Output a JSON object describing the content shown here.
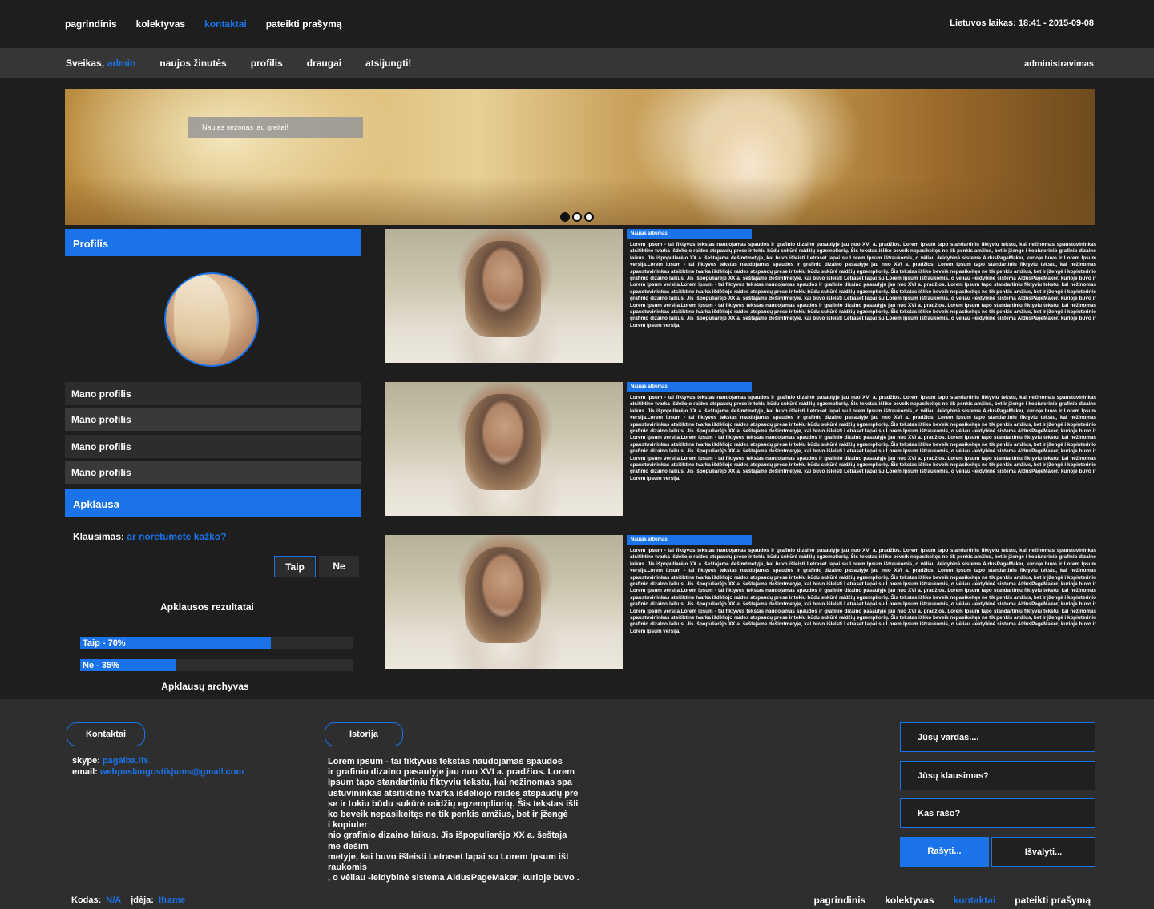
{
  "topnav": {
    "items": [
      "pagrindinis",
      "kolektyvas",
      "kontaktai",
      "pateikti prašymą"
    ],
    "active_index": 2,
    "clock": "Lietuvos laikas: 18:41 - 2015-09-08"
  },
  "userbar": {
    "greeting": "Sveikas,",
    "username": "admin",
    "items": [
      "naujos žinutės",
      "profilis",
      "draugai",
      "atsijungti!"
    ],
    "admin": "administravimas"
  },
  "banner": {
    "caption": "Naujas sezonas jau greitai!",
    "slides": 3,
    "active_slide": 0
  },
  "sidebar": {
    "profile_title": "Profilis",
    "menu": [
      "Mano profilis",
      "Mano profilis",
      "Mano profilis",
      "Mano profilis"
    ],
    "poll_title": "Apklausa",
    "question_label": "Klausimas:",
    "question": "ar norėtumėte kažko?",
    "yes": "Taip",
    "no": "Ne",
    "results_title": "Apklausos rezultatai",
    "results": [
      {
        "label": "Taip - 70%",
        "percent": 70
      },
      {
        "label": "Ne - 35%",
        "percent": 35
      }
    ],
    "archive": "Apklausų archyvas"
  },
  "articles": [
    {
      "tag": "Naujas albumas",
      "text": "Lorem ipsum - tai fiktyvus tekstas naudojamas spaudos ir grafinio dizaino pasaulyje jau nuo XVI a. pradžios. Lorem Ipsum tapo standartiniu fiktyviu tekstu, kai nežinomas spaustuvininkas atsitiktine tvarka išdėliojo raides atspaudų prese ir tokiu būdu sukūrė raidžių egzempliorių. Šis tekstas išliko beveik nepasikeitęs ne tik penkis amžius, bet ir įžengė i kopiuterinio grafinio dizaino laikus. Jis išpopuliarėjo XX a. šeštajame dešimtmetyje, kai buvo išleisti Letraset lapai su Lorem Ipsum ištraukomis, o vėliau -leidybinė sistema AldusPageMaker, kurioje buvo ir Lorem Ipsum versija.Lorem ipsum - tai fiktyvus tekstas naudojamas spaudos ir grafinio dizaino pasaulyje jau nuo XVI a. pradžios. Lorem Ipsum tapo standartiniu fiktyviu tekstu, kai nežinomas spaustuvininkas atsitiktine tvarka išdėliojo raides atspaudų prese ir tokiu būdu sukūrė raidžių egzempliorių. Šis tekstas išliko beveik nepasikeitęs ne tik penkis amžius, bet ir įžengė i kopiuterinio grafinio dizaino laikus. Jis išpopuliarėjo XX a. šeštajame dešimtmetyje, kai buvo išleisti Letraset lapai su Lorem Ipsum ištraukomis, o vėliau -leidybinė sistema AldusPageMaker, kurioje buvo ir Lorem Ipsum versija.Lorem ipsum - tai fiktyvus tekstas naudojamas spaudos ir grafinio dizaino pasaulyje jau nuo XVI a. pradžios. Lorem Ipsum tapo standartiniu fiktyviu tekstu, kai nežinomas spaustuvininkas atsitiktine tvarka išdėliojo raides atspaudų prese ir tokiu būdu sukūrė raidžių egzempliorių. Šis tekstas išliko beveik nepasikeitęs ne tik penkis amžius, bet ir įžengė i kopiuterinio grafinio dizaino laikus. Jis išpopuliarėjo XX a. šeštajame dešimtmetyje, kai buvo išleisti Letraset lapai su Lorem Ipsum ištraukomis, o vėliau -leidybinė sistema AldusPageMaker, kurioje buvo ir Lorem Ipsum versija.Lorem ipsum - tai fiktyvus tekstas naudojamas spaudos ir grafinio dizaino pasaulyje jau nuo XVI a. pradžios. Lorem Ipsum tapo standartiniu fiktyviu tekstu, kai nežinomas spaustuvininkas atsitiktine tvarka išdėliojo raides atspaudų prese ir tokiu būdu sukūrė raidžių egzempliorių. Šis tekstas išliko beveik nepasikeitęs ne tik penkis amžius, bet ir įžengė i kopiuterinio grafinio dizaino laikus. Jis išpopuliarėjo XX a. šeštajame dešimtmetyje, kai buvo išleisti Letraset lapai su Lorem Ipsum ištraukomis, o vėliau -leidybinė sistema AldusPageMaker, kurioje buvo ir Lorem Ipsum versija."
    },
    {
      "tag": "Naujas albumas",
      "text": "Lorem ipsum - tai fiktyvus tekstas naudojamas spaudos ir grafinio dizaino pasaulyje jau nuo XVI a. pradžios. Lorem Ipsum tapo standartiniu fiktyviu tekstu, kai nežinomas spaustuvininkas atsitiktine tvarka išdėliojo raides atspaudų prese ir tokiu būdu sukūrė raidžių egzempliorių. Šis tekstas išliko beveik nepasikeitęs ne tik penkis amžius, bet ir įžengė i kopiuterinio grafinio dizaino laikus. Jis išpopuliarėjo XX a. šeštajame dešimtmetyje, kai buvo išleisti Letraset lapai su Lorem Ipsum ištraukomis, o vėliau -leidybinė sistema AldusPageMaker, kurioje buvo ir Lorem Ipsum versija.Lorem ipsum - tai fiktyvus tekstas naudojamas spaudos ir grafinio dizaino pasaulyje jau nuo XVI a. pradžios. Lorem Ipsum tapo standartiniu fiktyviu tekstu, kai nežinomas spaustuvininkas atsitiktine tvarka išdėliojo raides atspaudų prese ir tokiu būdu sukūrė raidžių egzempliorių. Šis tekstas išliko beveik nepasikeitęs ne tik penkis amžius, bet ir įžengė i kopiuterinio grafinio dizaino laikus. Jis išpopuliarėjo XX a. šeštajame dešimtmetyje, kai buvo išleisti Letraset lapai su Lorem Ipsum ištraukomis, o vėliau -leidybinė sistema AldusPageMaker, kurioje buvo ir Lorem Ipsum versija.Lorem ipsum - tai fiktyvus tekstas naudojamas spaudos ir grafinio dizaino pasaulyje jau nuo XVI a. pradžios. Lorem Ipsum tapo standartiniu fiktyviu tekstu, kai nežinomas spaustuvininkas atsitiktine tvarka išdėliojo raides atspaudų prese ir tokiu būdu sukūrė raidžių egzempliorių. Šis tekstas išliko beveik nepasikeitęs ne tik penkis amžius, bet ir įžengė i kopiuterinio grafinio dizaino laikus. Jis išpopuliarėjo XX a. šeštajame dešimtmetyje, kai buvo išleisti Letraset lapai su Lorem Ipsum ištraukomis, o vėliau -leidybinė sistema AldusPageMaker, kurioje buvo ir Lorem Ipsum versija.Lorem ipsum - tai fiktyvus tekstas naudojamas spaudos ir grafinio dizaino pasaulyje jau nuo XVI a. pradžios. Lorem Ipsum tapo standartiniu fiktyviu tekstu, kai nežinomas spaustuvininkas atsitiktine tvarka išdėliojo raides atspaudų prese ir tokiu būdu sukūrė raidžių egzempliorių. Šis tekstas išliko beveik nepasikeitęs ne tik penkis amžius, bet ir įžengė i kopiuterinio grafinio dizaino laikus. Jis išpopuliarėjo XX a. šeštajame dešimtmetyje, kai buvo išleisti Letraset lapai su Lorem Ipsum ištraukomis, o vėliau -leidybinė sistema AldusPageMaker, kurioje buvo ir Lorem Ipsum versija."
    },
    {
      "tag": "Naujas albumas",
      "text": "Lorem ipsum - tai fiktyvus tekstas naudojamas spaudos ir grafinio dizaino pasaulyje jau nuo XVI a. pradžios. Lorem Ipsum tapo standartiniu fiktyviu tekstu, kai nežinomas spaustuvininkas atsitiktine tvarka išdėliojo raides atspaudų prese ir tokiu būdu sukūrė raidžių egzempliorių. Šis tekstas išliko beveik nepasikeitęs ne tik penkis amžius, bet ir įžengė i kopiuterinio grafinio dizaino laikus. Jis išpopuliarėjo XX a. šeštajame dešimtmetyje, kai buvo išleisti Letraset lapai su Lorem Ipsum ištraukomis, o vėliau -leidybinė sistema AldusPageMaker, kurioje buvo ir Lorem Ipsum versija.Lorem ipsum - tai fiktyvus tekstas naudojamas spaudos ir grafinio dizaino pasaulyje jau nuo XVI a. pradžios. Lorem Ipsum tapo standartiniu fiktyviu tekstu, kai nežinomas spaustuvininkas atsitiktine tvarka išdėliojo raides atspaudų prese ir tokiu būdu sukūrė raidžių egzempliorių. Šis tekstas išliko beveik nepasikeitęs ne tik penkis amžius, bet ir įžengė i kopiuterinio grafinio dizaino laikus. Jis išpopuliarėjo XX a. šeštajame dešimtmetyje, kai buvo išleisti Letraset lapai su Lorem Ipsum ištraukomis, o vėliau -leidybinė sistema AldusPageMaker, kurioje buvo ir Lorem Ipsum versija.Lorem ipsum - tai fiktyvus tekstas naudojamas spaudos ir grafinio dizaino pasaulyje jau nuo XVI a. pradžios. Lorem Ipsum tapo standartiniu fiktyviu tekstu, kai nežinomas spaustuvininkas atsitiktine tvarka išdėliojo raides atspaudų prese ir tokiu būdu sukūrė raidžių egzempliorių. Šis tekstas išliko beveik nepasikeitęs ne tik penkis amžius, bet ir įžengė i kopiuterinio grafinio dizaino laikus. Jis išpopuliarėjo XX a. šeštajame dešimtmetyje, kai buvo išleisti Letraset lapai su Lorem Ipsum ištraukomis, o vėliau -leidybinė sistema AldusPageMaker, kurioje buvo ir Lorem Ipsum versija.Lorem ipsum - tai fiktyvus tekstas naudojamas spaudos ir grafinio dizaino pasaulyje jau nuo XVI a. pradžios. Lorem Ipsum tapo standartiniu fiktyviu tekstu, kai nežinomas spaustuvininkas atsitiktine tvarka išdėliojo raides atspaudų prese ir tokiu būdu sukūrė raidžių egzempliorių. Šis tekstas išliko beveik nepasikeitęs ne tik penkis amžius, bet ir įžengė i kopiuterinio grafinio dizaino laikus. Jis išpopuliarėjo XX a. šeštajame dešimtmetyje, kai buvo išleisti Letraset lapai su Lorem Ipsum ištraukomis, o vėliau -leidybinė sistema AldusPageMaker, kurioje buvo ir Lorem Ipsum versija."
    }
  ],
  "footer": {
    "contacts_title": "Kontaktai",
    "skype_label": "skype:",
    "skype": "pagalba.lfs",
    "email_label": "email:",
    "email": "webpaslaugostikjums@gmail.com",
    "history_title": "Istorija",
    "history_text": "Lorem ipsum - tai fiktyvus tekstas naudojamas spaudos\nir grafinio dizaino pasaulyje jau nuo XVI a. pradžios. Lorem\n Ipsum tapo standartiniu fiktyviu tekstu, kai nežinomas spa\nustuvininkas atsitiktine tvarka išdėliojo raides atspaudų pre\nse ir tokiu būdu sukūrė raidžių egzempliorių. Šis tekstas išli\nko beveik nepasikeitęs ne tik penkis amžius, bet ir įžengė\n i kopiuter\nnio grafinio dizaino laikus. Jis išpopuliarėjo XX a. šeštaja\nme dešim\nmetyje, kai buvo išleisti Letraset lapai su Lorem Ipsum išt\nraukomis\n, o vėliau -leidybinė sistema AldusPageMaker, kurioje buvo .",
    "form": {
      "name_placeholder": "Jūsų vardas....",
      "question_placeholder": "Jūsų klausimas?",
      "who_placeholder": "Kas rašo?",
      "write": "Rašyti...",
      "clear": "Išvalyti..."
    },
    "credits": {
      "code_label": "Kodas:",
      "code": "N/A",
      "idea_label": "įdėja:",
      "idea": "Iframe"
    },
    "nav": [
      "pagrindinis",
      "kolektyvas",
      "kontaktai",
      "pateikti prašymą"
    ],
    "active_index": 2
  },
  "colors": {
    "accent": "#1a73e8",
    "background": "#1e1e1f",
    "panel": "#2e2d2d",
    "userbar": "#363637"
  }
}
